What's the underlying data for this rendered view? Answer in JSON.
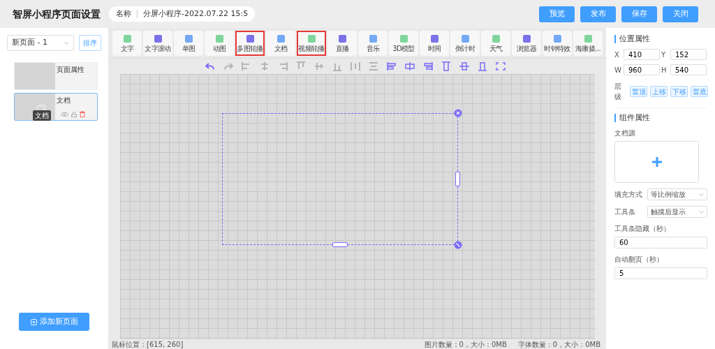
{
  "header": {
    "title": "智屏小程序页面设置",
    "name_label": "名称",
    "name_value": "分屏小程序-2022.07.22 15:5",
    "buttons": [
      "预览",
      "发布",
      "保存",
      "关闭"
    ]
  },
  "sidebar": {
    "page_select": "新页面 - 1",
    "sort_button": "排序",
    "pages": [
      {
        "title": "页面属性",
        "selected": false,
        "has_content": false
      },
      {
        "title": "文档",
        "selected": true,
        "has_content": true,
        "tooltip": "文档"
      }
    ],
    "add_button": "添加新页面"
  },
  "components": [
    {
      "label": "文字",
      "color": "#7ed69a",
      "highlighted": false
    },
    {
      "label": "文字滚动",
      "color": "#7b72e9",
      "highlighted": false
    },
    {
      "label": "单图",
      "color": "#74a9f7",
      "highlighted": false
    },
    {
      "label": "动图",
      "color": "#7ed69a",
      "highlighted": false
    },
    {
      "label": "多图轮播",
      "color": "#7b72e9",
      "highlighted": true
    },
    {
      "label": "文档",
      "color": "#74a9f7",
      "highlighted": false
    },
    {
      "label": "视频轮播",
      "color": "#7ed69a",
      "highlighted": true
    },
    {
      "label": "直播",
      "color": "#7b72e9",
      "highlighted": false
    },
    {
      "label": "音乐",
      "color": "#74a9f7",
      "highlighted": false
    },
    {
      "label": "3D模型",
      "color": "#7ed69a",
      "highlighted": false
    },
    {
      "label": "时间",
      "color": "#7b72e9",
      "highlighted": false
    },
    {
      "label": "倒计时",
      "color": "#74a9f7",
      "highlighted": false
    },
    {
      "label": "天气",
      "color": "#7ed69a",
      "highlighted": false
    },
    {
      "label": "浏览器",
      "color": "#7b72e9",
      "highlighted": false
    },
    {
      "label": "时钟特效",
      "color": "#74a9f7",
      "highlighted": false
    },
    {
      "label": "海康摄...",
      "color": "#7ed69a",
      "highlighted": false
    }
  ],
  "tools": [
    {
      "kind": "undo",
      "enabled": true
    },
    {
      "kind": "redo",
      "enabled": false
    },
    {
      "kind": "align-left",
      "enabled": false
    },
    {
      "kind": "align-center",
      "enabled": false
    },
    {
      "kind": "align-right",
      "enabled": false
    },
    {
      "kind": "align-top",
      "enabled": false
    },
    {
      "kind": "align-middle",
      "enabled": false
    },
    {
      "kind": "align-bottom",
      "enabled": false
    },
    {
      "kind": "distribute-h",
      "enabled": false
    },
    {
      "kind": "distribute-v",
      "enabled": false
    },
    {
      "kind": "snap-left",
      "enabled": true
    },
    {
      "kind": "snap-center",
      "enabled": true
    },
    {
      "kind": "snap-right",
      "enabled": true
    },
    {
      "kind": "snap-top",
      "enabled": true
    },
    {
      "kind": "snap-middle",
      "enabled": true
    },
    {
      "kind": "snap-bottom",
      "enabled": true
    },
    {
      "kind": "fullscreen",
      "enabled": true
    }
  ],
  "status_bar": {
    "mouse": "鼠标位置：[615, 260]",
    "images": "图片数量：0，大小：0MB",
    "fonts": "字体数量：0，大小：0MB"
  },
  "properties": {
    "position_title": "位置属性",
    "fields": [
      {
        "label": "X",
        "value": "410"
      },
      {
        "label": "Y",
        "value": "152"
      },
      {
        "label": "W",
        "value": "960"
      },
      {
        "label": "H",
        "value": "540"
      }
    ],
    "layer_label": "层级",
    "layer_buttons": [
      "置顶",
      "上移",
      "下移",
      "置底"
    ],
    "component_title": "组件属性",
    "source_label": "文档源",
    "fill_label": "填充方式",
    "fill_value": "等比例缩放",
    "toolbar_label": "工具条",
    "toolbar_value": "触摸后显示",
    "hide_label": "工具条隐藏（秒）",
    "hide_value": "60",
    "page_label": "自动翻页（秒）",
    "page_value": "5"
  }
}
